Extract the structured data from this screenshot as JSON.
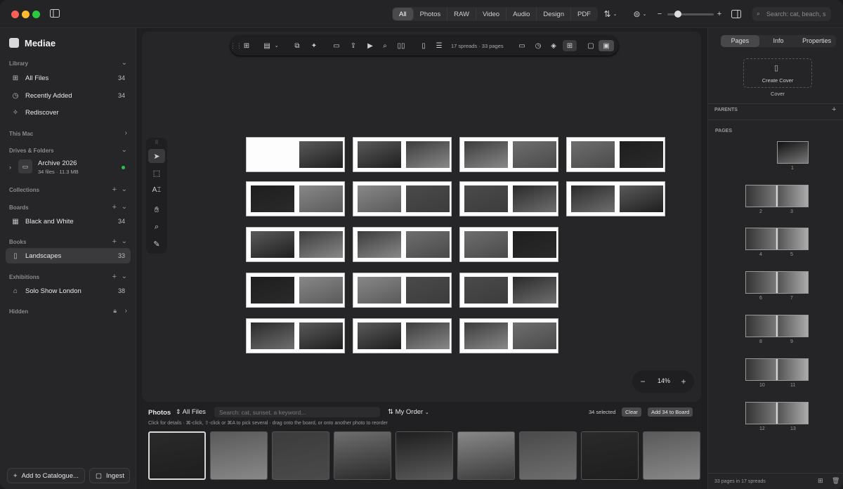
{
  "filters": [
    "All",
    "Photos",
    "RAW",
    "Video",
    "Audio",
    "Design",
    "PDF"
  ],
  "search_placeholder": "Search: cat, beach, s",
  "app_name": "Mediae",
  "library": {
    "header": "Library",
    "items": [
      {
        "label": "All Files",
        "count": "34"
      },
      {
        "label": "Recently Added",
        "count": "34"
      },
      {
        "label": "Rediscover",
        "count": ""
      }
    ]
  },
  "this_mac": "This Mac",
  "drives": {
    "header": "Drives & Folders",
    "name": "Archive 2026",
    "sub": "34 files · 11.3 MB"
  },
  "collections": "Collections",
  "boards": {
    "header": "Boards",
    "items": [
      {
        "label": "Black and White",
        "count": "34"
      }
    ]
  },
  "books": {
    "header": "Books",
    "items": [
      {
        "label": "Landscapes",
        "count": "33"
      }
    ]
  },
  "exhibitions": {
    "header": "Exhibitions",
    "items": [
      {
        "label": "Solo Show London",
        "count": "38"
      }
    ]
  },
  "hidden": "Hidden",
  "footer": {
    "add": "Add to Catalogue...",
    "ingest": "Ingest"
  },
  "toolbar": {
    "status": "17 spreads · 33 pages"
  },
  "zoom": {
    "level": "14%"
  },
  "strip": {
    "title": "Photos",
    "filter": "All Files",
    "search_placeholder": "Search: cat, sunset, a keyword...",
    "order": "My Order",
    "selected": "34 selected",
    "clear": "Clear",
    "add_button": "Add 34 to Board",
    "hint": "Click for details · ⌘-click, ⇧-click or ⌘A to pick several · drag onto the board, or onto another photo to reorder"
  },
  "right": {
    "tabs": [
      "Pages",
      "Info",
      "Properties"
    ],
    "create_cover": "Create Cover",
    "cover": "Cover",
    "parents": "PARENTS",
    "pages": "PAGES",
    "page_numbers": [
      [
        "1"
      ],
      [
        "2",
        "3"
      ],
      [
        "4",
        "5"
      ],
      [
        "6",
        "7"
      ],
      [
        "8",
        "9"
      ],
      [
        "10",
        "11"
      ],
      [
        "12",
        "13"
      ]
    ],
    "footer": "33 pages in 17 spreads"
  },
  "colors": {
    "accent": "#2fbf4f",
    "close": "#ff5f57",
    "min": "#febc2e",
    "max": "#28c840"
  }
}
